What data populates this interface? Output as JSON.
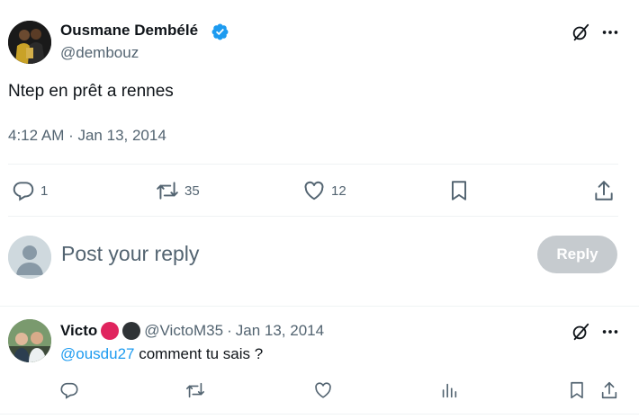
{
  "main_tweet": {
    "author": {
      "display_name": "Ousmane Dembélé",
      "handle": "@dembouz",
      "verified": true,
      "verified_color": "#1d9bf0"
    },
    "text": "Ntep en prêt a rennes",
    "timestamp": "4:12 AM · Jan 13, 2014",
    "actions": {
      "reply_count": "1",
      "retweet_count": "35",
      "like_count": "12"
    },
    "icons": [
      "grok-icon",
      "more-icon",
      "reply-icon",
      "retweet-icon",
      "like-icon",
      "bookmark-icon",
      "share-icon"
    ]
  },
  "composer": {
    "placeholder": "Post your reply",
    "reply_button_label": "Reply",
    "reply_button_color": "#c6cbcf"
  },
  "reply_tweet": {
    "author": {
      "display_name": "Victo",
      "handle": "@VictoM35",
      "separator": "·",
      "date": "Jan 13, 2014",
      "emoji_colors": [
        "#e0245e",
        "#2f3336"
      ]
    },
    "mention": "@ousdu27",
    "text": " comment tu sais ?",
    "mention_color": "#1d9bf0",
    "icons": [
      "reply-icon",
      "retweet-icon",
      "like-icon",
      "views-icon",
      "bookmark-icon",
      "share-icon"
    ]
  }
}
